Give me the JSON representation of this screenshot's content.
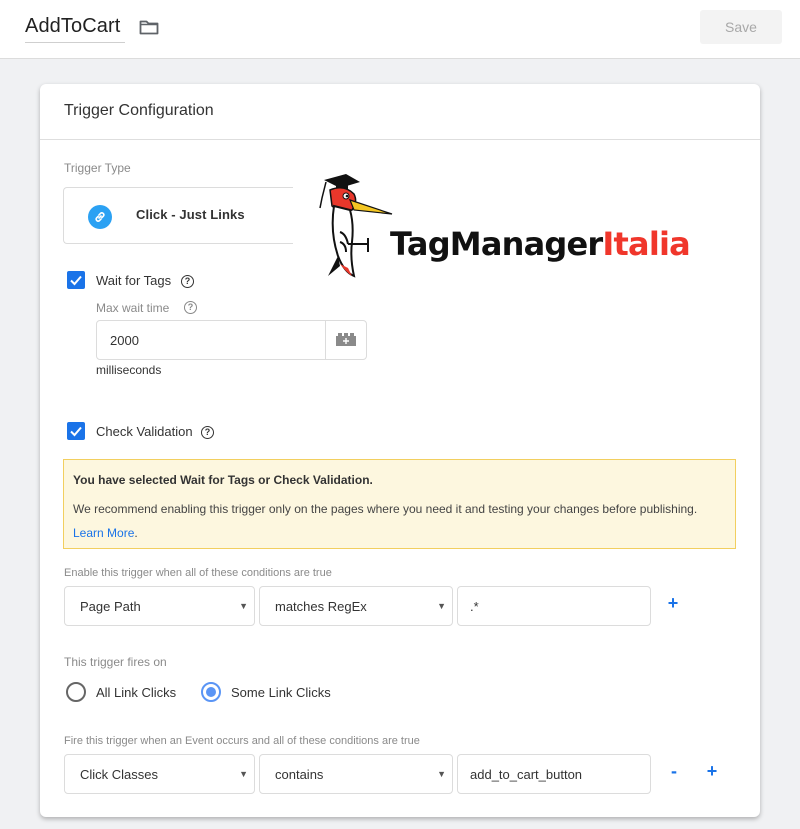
{
  "header": {
    "title": "AddToCart",
    "folder_icon": "folder-icon",
    "save_label": "Save"
  },
  "card": {
    "title": "Trigger Configuration",
    "trigger_type": {
      "label": "Trigger Type",
      "icon": "link-icon",
      "value": "Click - Just Links"
    },
    "logo": {
      "text_primary": "TagManager",
      "text_accent": "Italia",
      "accent_color": "#f0362b"
    },
    "wait_for_tags": {
      "checked": true,
      "label": "Wait for Tags",
      "max_wait_label": "Max wait time",
      "max_wait_value": "2000",
      "unit": "milliseconds"
    },
    "check_validation": {
      "checked": true,
      "label": "Check Validation"
    },
    "warning": {
      "title": "You have selected Wait for Tags or Check Validation.",
      "body": "We recommend enabling this trigger only on the pages where you need it and testing your changes before publishing. ",
      "link": "Learn More",
      "after_link": "."
    },
    "enable_conditions": {
      "label": "Enable this trigger when all of these conditions are true",
      "variable": "Page Path",
      "operator": "matches RegEx",
      "value": ".*",
      "add_label": "+"
    },
    "fires_on": {
      "label": "This trigger fires on",
      "options": [
        {
          "label": "All Link Clicks",
          "selected": false
        },
        {
          "label": "Some Link Clicks",
          "selected": true
        }
      ]
    },
    "fire_conditions": {
      "label": "Fire this trigger when an Event occurs and all of these conditions are true",
      "variable": "Click Classes",
      "operator": "contains",
      "value": "add_to_cart_button",
      "remove_label": "-",
      "add_label": "+"
    }
  },
  "colors": {
    "accent_blue": "#1a73e8",
    "link_icon_bg": "#2ba1f3",
    "warning_bg": "#fdf7df",
    "warning_border": "#f2cf5f"
  }
}
